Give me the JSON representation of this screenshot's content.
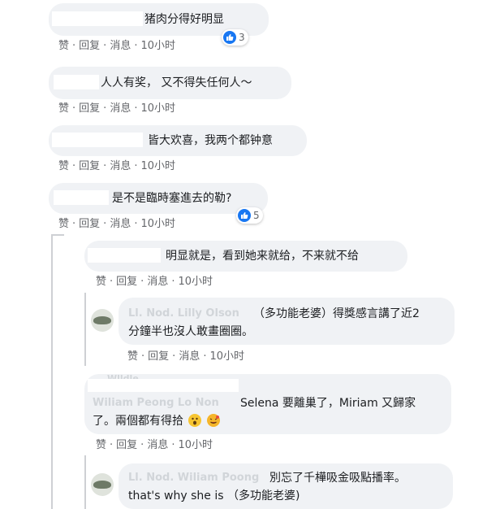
{
  "comments": [
    {
      "text": "猪肉分得好明显",
      "reaction_count": "3"
    },
    {
      "text": "人人有奖， 又不得失任何人～"
    },
    {
      "text": "皆大欢喜，我两个都钟意"
    },
    {
      "text": "是不是臨時塞進去的勒?",
      "reaction_count": "5"
    },
    {
      "text": "明显就是，看到她来就给，不来就不给"
    },
    {
      "text_line1": "（多功能老婆）得獎感言講了近2",
      "text_line2": "分鐘半也沒人敢畫圈圈。"
    },
    {
      "text_line1": "Selena 要離巢了，Miriam 又歸家",
      "text_line2": "了。兩個都有得拾"
    },
    {
      "text_line1": "別忘了千樺吸金吸點播率。",
      "text_line2": "that's why she is （多功能老婆)"
    }
  ],
  "actions": {
    "like": "赞",
    "reply": "回复",
    "message": "消息",
    "time": "10小时"
  },
  "colors": {
    "bubble": "#f0f2f5",
    "meta_text": "#65676b",
    "like_blue": "#1877f2"
  },
  "icons": [
    "thumbs-up-icon",
    "avatar-icon",
    "emoji-face-icon",
    "thread-line"
  ]
}
